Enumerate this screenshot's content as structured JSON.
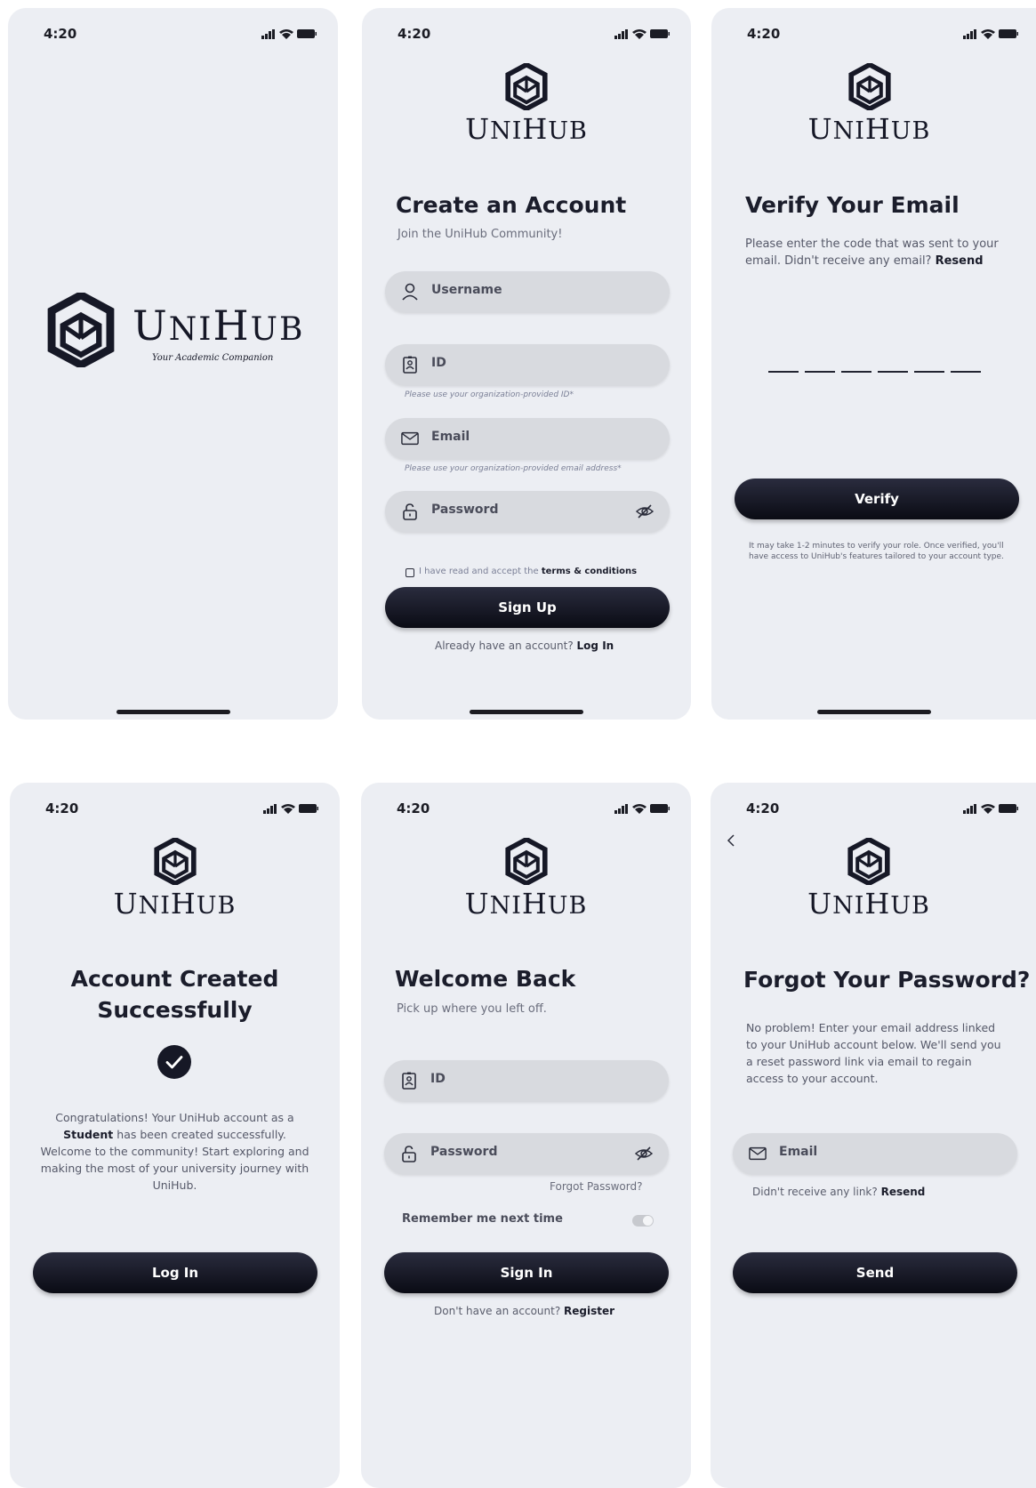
{
  "status": {
    "time": "4:20"
  },
  "brand": {
    "name_u": "U",
    "name_ni": "NI",
    "name_h": "H",
    "name_ub": "UB",
    "tagline": "Your Academic Companion"
  },
  "signup": {
    "title": "Create an Account",
    "subtitle": "Join the UniHub Community!",
    "username_placeholder": "Username",
    "id_placeholder": "ID",
    "id_hint": "Please use your organization-provided ID*",
    "email_placeholder": "Email",
    "email_hint": "Please use your organization-provided email address*",
    "password_placeholder": "Password",
    "terms_prefix": "I have read and accept the",
    "terms_link": "terms & conditions",
    "button": "Sign Up",
    "footer_prefix": "Already have an account?",
    "footer_link": "Log In"
  },
  "verify": {
    "title": "Verify Your Email",
    "text": "Please enter the code that was sent to your email. Didn't receive any email?",
    "resend": "Resend",
    "button": "Verify",
    "note": "It may take 1-2 minutes to verify your role. Once verified, you'll have access to UniHub's features tailored to your account type."
  },
  "created": {
    "title_line1": "Account Created",
    "title_line2": "Successfully",
    "text_prefix": "Congratulations! Your UniHub account as a",
    "role": "Student",
    "text_suffix": "has been created successfully. Welcome to the community! Start exploring and making the most of your university journey with UniHub.",
    "button": "Log In"
  },
  "login": {
    "title": "Welcome Back",
    "subtitle": "Pick up where you left off.",
    "id_placeholder": "ID",
    "password_placeholder": "Password",
    "forgot": "Forgot Password?",
    "remember": "Remember me next time",
    "button": "Sign In",
    "footer_prefix": "Don't have an account?",
    "footer_link": "Register"
  },
  "forgot": {
    "title": "Forgot Your Password?",
    "text": "No problem! Enter your email address linked to your UniHub account below. We'll send you a reset password link via email to regain access to your account.",
    "email_placeholder": "Email",
    "hint_prefix": "Didn't receive any link?",
    "hint_link": "Resend",
    "button": "Send"
  }
}
